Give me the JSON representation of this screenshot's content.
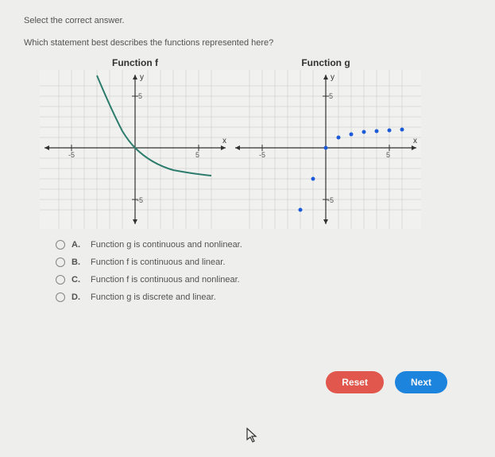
{
  "instruction": "Select the correct answer.",
  "question": "Which statement best describes the functions represented here?",
  "graphs": {
    "f": {
      "title": "Function f",
      "ylabel": "y",
      "xlabel": "x",
      "ticks": {
        "xneg": "-5",
        "xpos": "5",
        "yneg": "-5",
        "ypos": "5"
      }
    },
    "g": {
      "title": "Function g",
      "ylabel": "y",
      "xlabel": "x",
      "ticks": {
        "xneg": "-5",
        "xpos": "5",
        "yneg": "-5",
        "ypos": "5"
      }
    }
  },
  "choices": [
    {
      "letter": "A.",
      "text": "Function g is continuous and nonlinear."
    },
    {
      "letter": "B.",
      "text": "Function f is continuous and linear."
    },
    {
      "letter": "C.",
      "text": "Function f is continuous and nonlinear."
    },
    {
      "letter": "D.",
      "text": "Function g is discrete and linear."
    }
  ],
  "buttons": {
    "reset": "Reset",
    "next": "Next"
  },
  "chart_data": [
    {
      "type": "line",
      "title": "Function f",
      "xlabel": "x",
      "ylabel": "y",
      "xlim": [
        -7,
        7
      ],
      "ylim": [
        -7,
        7
      ],
      "series": [
        {
          "name": "f",
          "x": [
            -3,
            -2.5,
            -2,
            -1.5,
            -1,
            -0.5,
            0,
            1,
            2,
            3,
            4,
            5,
            6
          ],
          "y": [
            7,
            5.2,
            3.8,
            2.6,
            1.6,
            0.8,
            0,
            -1.4,
            -2.0,
            -2.3,
            -2.5,
            -2.6,
            -2.7
          ]
        }
      ]
    },
    {
      "type": "scatter",
      "title": "Function g",
      "xlabel": "x",
      "ylabel": "y",
      "xlim": [
        -7,
        7
      ],
      "ylim": [
        -7,
        7
      ],
      "series": [
        {
          "name": "g",
          "x": [
            -2,
            -1,
            0,
            1,
            2,
            3,
            4,
            5,
            6
          ],
          "y": [
            -6,
            -3,
            0,
            1,
            1.3,
            1.5,
            1.6,
            1.7,
            1.8
          ]
        }
      ]
    }
  ]
}
